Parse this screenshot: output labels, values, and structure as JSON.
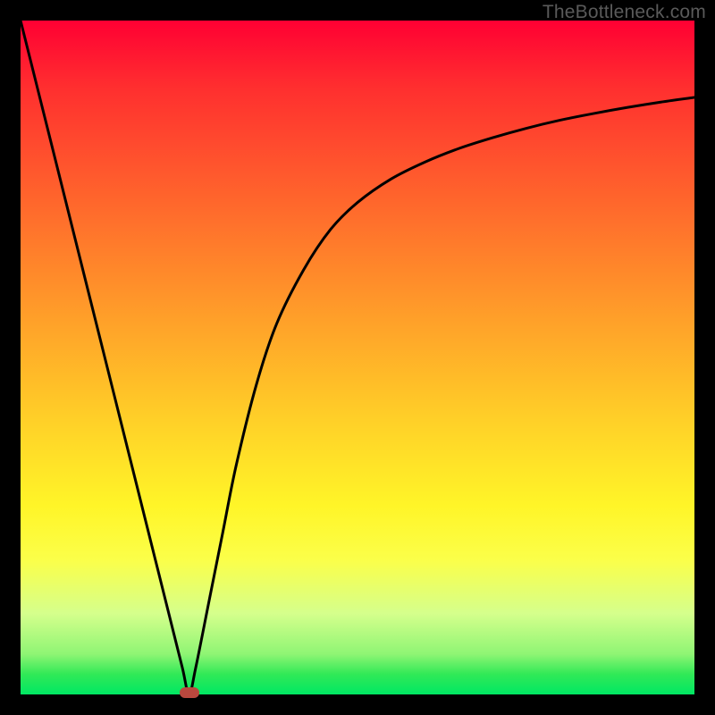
{
  "watermark": "TheBottleneck.com",
  "chart_data": {
    "type": "line",
    "title": "",
    "xlabel": "",
    "ylabel": "",
    "xlim": [
      0,
      100
    ],
    "ylim": [
      0,
      100
    ],
    "series": [
      {
        "name": "bottleneck-curve",
        "x": [
          0,
          5,
          10,
          15,
          20,
          22,
          24,
          25,
          26,
          28,
          30,
          32,
          35,
          38,
          42,
          46,
          50,
          55,
          60,
          65,
          70,
          75,
          80,
          85,
          90,
          95,
          100
        ],
        "values": [
          100,
          80,
          60,
          40,
          20,
          12,
          4,
          0,
          4,
          14,
          24,
          34,
          46,
          55,
          63,
          69,
          73,
          76.5,
          79,
          81,
          82.6,
          84,
          85.2,
          86.2,
          87.1,
          87.9,
          88.6
        ]
      }
    ],
    "marker": {
      "x_percent": 25,
      "y_percent": 0,
      "color": "#ba483e"
    },
    "gradient_stops": [
      {
        "pos": 0,
        "color": "#ff0033"
      },
      {
        "pos": 10,
        "color": "#ff2f2f"
      },
      {
        "pos": 28,
        "color": "#ff6a2c"
      },
      {
        "pos": 45,
        "color": "#ffa229"
      },
      {
        "pos": 60,
        "color": "#ffd228"
      },
      {
        "pos": 72,
        "color": "#fff528"
      },
      {
        "pos": 80,
        "color": "#fbff49"
      },
      {
        "pos": 88,
        "color": "#d5ff8c"
      },
      {
        "pos": 94,
        "color": "#8ff574"
      },
      {
        "pos": 97,
        "color": "#31e957"
      },
      {
        "pos": 100,
        "color": "#00e763"
      }
    ]
  }
}
